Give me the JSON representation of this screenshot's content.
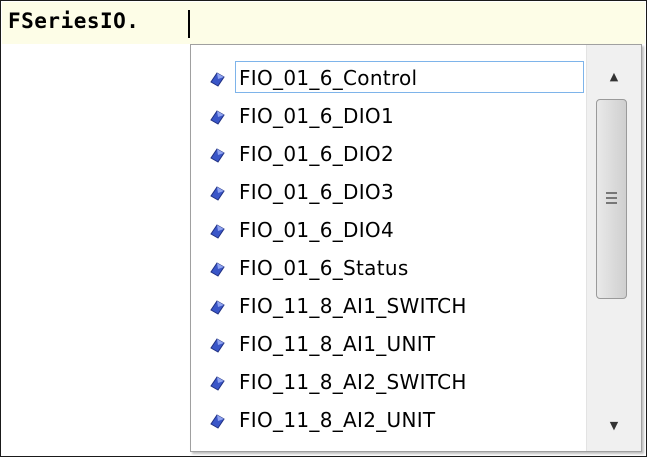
{
  "editor": {
    "text": "FSeriesIO."
  },
  "autocomplete": {
    "items": [
      {
        "label": "FIO_01_6_Control",
        "icon": "member-icon",
        "selected": true
      },
      {
        "label": "FIO_01_6_DIO1",
        "icon": "member-icon"
      },
      {
        "label": "FIO_01_6_DIO2",
        "icon": "member-icon"
      },
      {
        "label": "FIO_01_6_DIO3",
        "icon": "member-icon"
      },
      {
        "label": "FIO_01_6_DIO4",
        "icon": "member-icon"
      },
      {
        "label": "FIO_01_6_Status",
        "icon": "member-icon"
      },
      {
        "label": "FIO_11_8_AI1_SWITCH",
        "icon": "member-icon"
      },
      {
        "label": "FIO_11_8_AI1_UNIT",
        "icon": "member-icon"
      },
      {
        "label": "FIO_11_8_AI2_SWITCH",
        "icon": "member-icon"
      },
      {
        "label": "FIO_11_8_AI2_UNIT",
        "icon": "member-icon"
      }
    ],
    "scrollbar": {
      "up_icon": "▲",
      "down_icon": "▼"
    }
  },
  "colors": {
    "editor_line_bg": "#fdfde7",
    "selection_border": "#7eb4ea",
    "icon_blue": "#3a56c8"
  }
}
